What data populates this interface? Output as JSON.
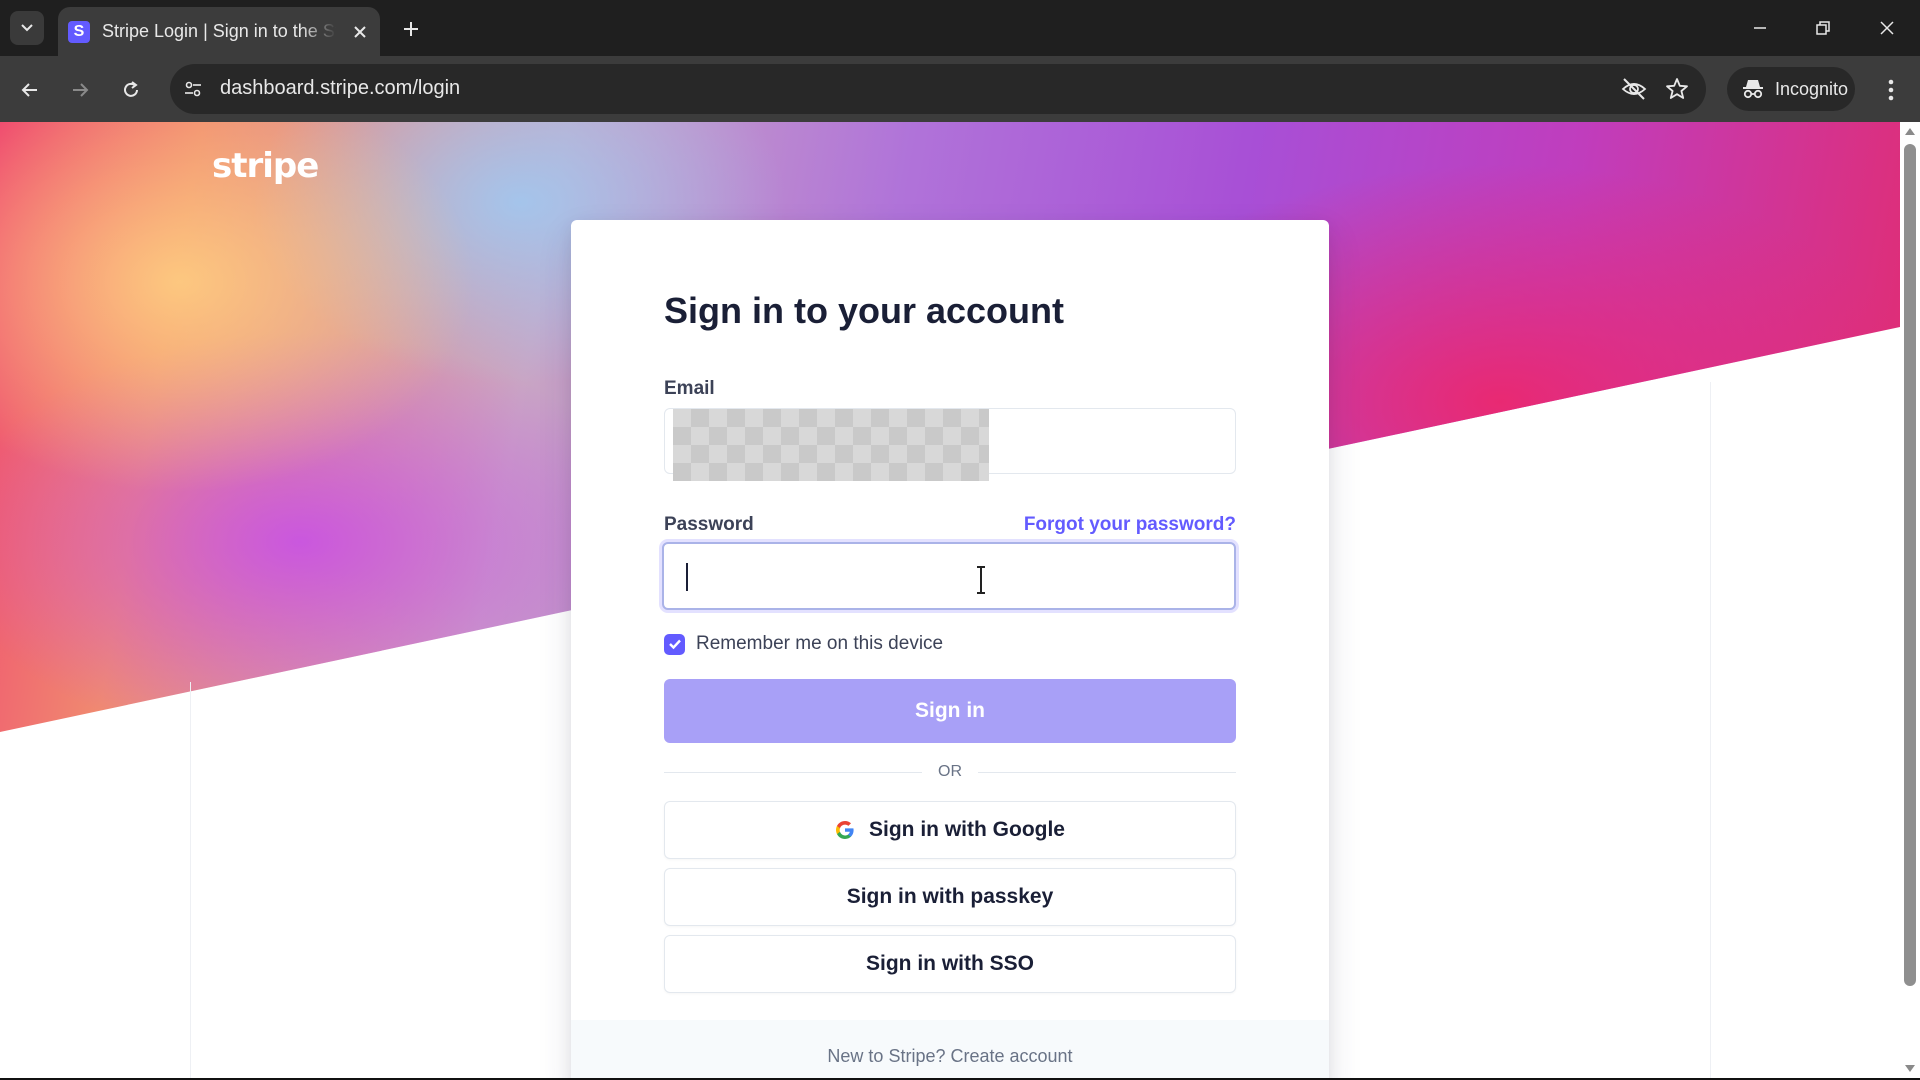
{
  "browser": {
    "tab_title": "Stripe Login | Sign in to the Stripe Dashboard",
    "tab_favicon_letter": "S",
    "url": "dashboard.stripe.com/login",
    "incognito_label": "Incognito"
  },
  "page": {
    "logo": "stripe",
    "heading": "Sign in to your account",
    "email_label": "Email",
    "password_label": "Password",
    "forgot_link": "Forgot your password?",
    "remember_label": "Remember me on this device",
    "remember_checked": true,
    "signin_button": "Sign in",
    "divider": "OR",
    "google_button": "Sign in with Google",
    "passkey_button": "Sign in with passkey",
    "sso_button": "Sign in with SSO",
    "footer_text": "New to Stripe? Create account"
  },
  "colors": {
    "brand": "#635bff",
    "signin_button_bg": "#a8a0f7",
    "heading_text": "#1a1f36"
  }
}
